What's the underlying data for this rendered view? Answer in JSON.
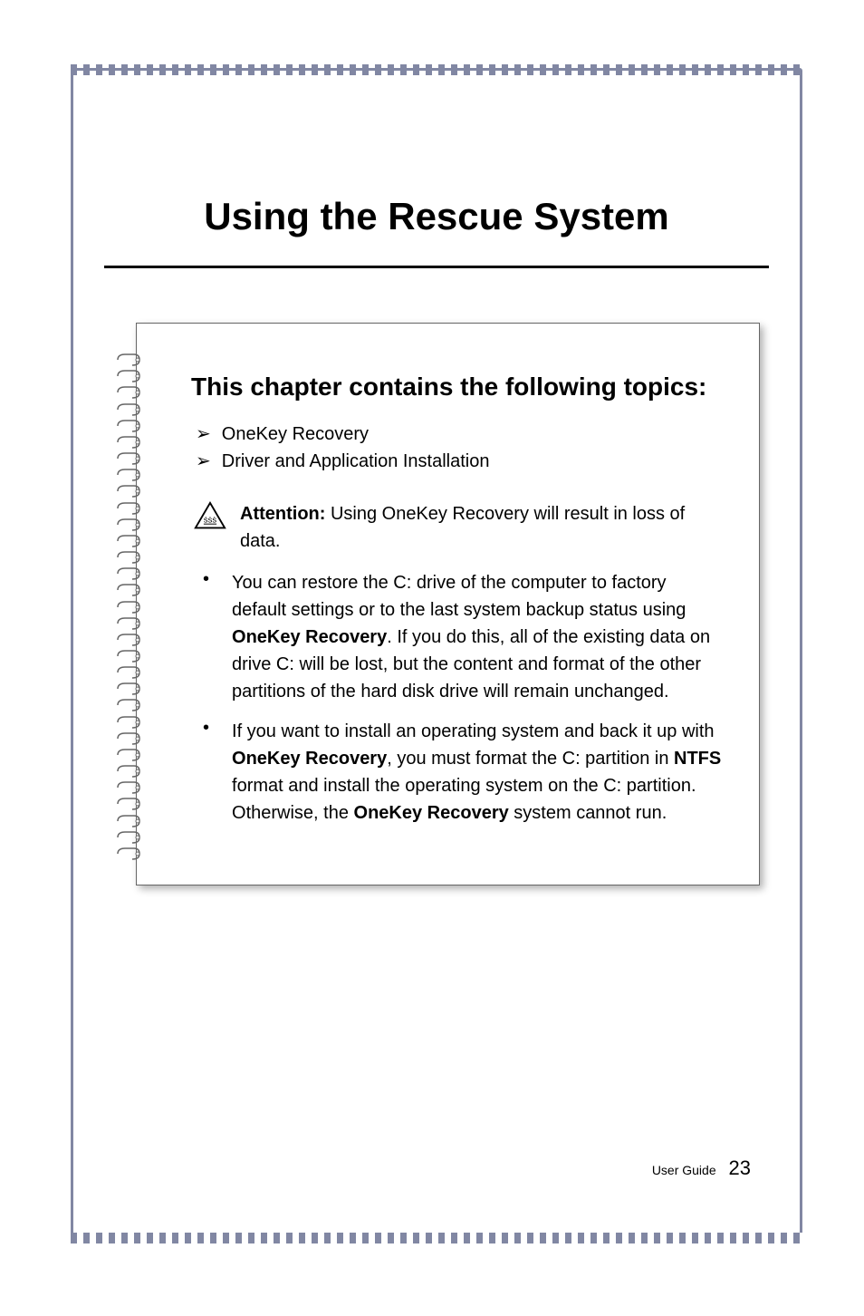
{
  "title": "Using the Rescue System",
  "chapter_heading": "This chapter contains the following topics:",
  "topics": [
    "OneKey Recovery",
    "Driver and Application Installation"
  ],
  "attention": {
    "label": "Attention:",
    "text": " Using OneKey Recovery will result in loss of data."
  },
  "bullets": [
    {
      "text_parts": [
        {
          "text": "You can restore the C: drive of the computer to factory default settings or to the last system backup status using ",
          "bold": false
        },
        {
          "text": "OneKey Recovery",
          "bold": true
        },
        {
          "text": ". If you do this, all of the existing data on drive C: will be lost, but the content and format of the other partitions of the hard disk drive will remain unchanged.",
          "bold": false
        }
      ]
    },
    {
      "text_parts": [
        {
          "text": "If you want to install an operating system and back it up with ",
          "bold": false
        },
        {
          "text": "OneKey Recovery",
          "bold": true
        },
        {
          "text": ", you must format the C: partition in ",
          "bold": false
        },
        {
          "text": "NTFS",
          "bold": true
        },
        {
          "text": " format and install the operating system on the C: partition. Otherwise, the ",
          "bold": false
        },
        {
          "text": "OneKey Recovery",
          "bold": true
        },
        {
          "text": " system cannot run.",
          "bold": false
        }
      ]
    }
  ],
  "footer": {
    "label": "User Guide",
    "page": "23"
  }
}
